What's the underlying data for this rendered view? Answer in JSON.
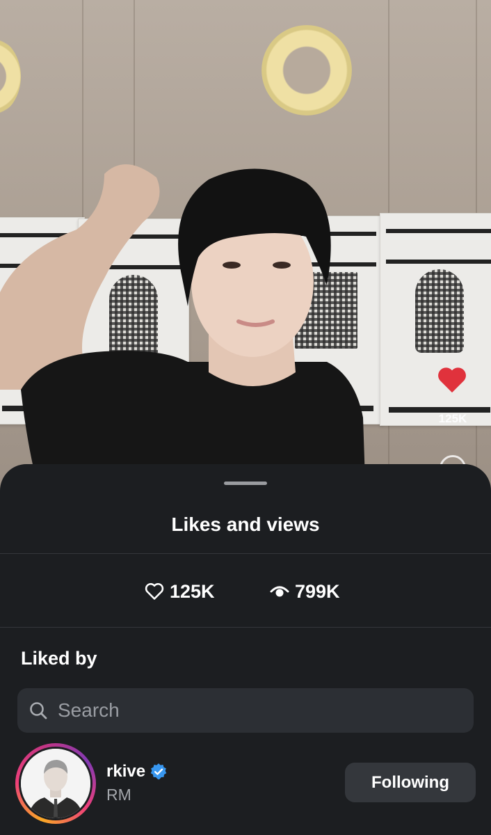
{
  "video": {
    "floating_like_count": "125K"
  },
  "sheet": {
    "title": "Likes and views",
    "stats": {
      "likes": "125K",
      "views": "799K"
    },
    "liked_by_heading": "Liked by",
    "search": {
      "placeholder": "Search"
    },
    "users": [
      {
        "username": "rkive",
        "full_name": "RM",
        "verified": true,
        "action_label": "Following"
      }
    ]
  },
  "colors": {
    "sheet_background": "#1c1e21",
    "verified_badge": "#3897f0",
    "heart_float": "#e0323c"
  }
}
